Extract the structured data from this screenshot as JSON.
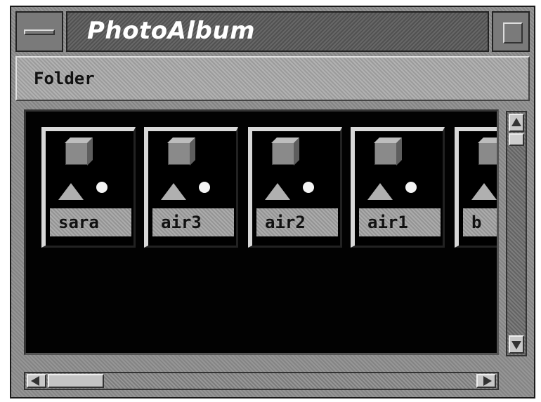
{
  "window": {
    "title": "PhotoAlbum"
  },
  "menubar": {
    "items": [
      {
        "label": "Folder"
      }
    ]
  },
  "album": {
    "items": [
      {
        "label": "sara"
      },
      {
        "label": "air3"
      },
      {
        "label": "air2"
      },
      {
        "label": "air1"
      },
      {
        "label": "b"
      }
    ]
  },
  "icons": {
    "window_menu": "window-menu-icon",
    "maximize": "maximize-icon",
    "album_thumbnail": "scene-thumbnail-icon"
  },
  "colors": {
    "content_background": "#020202",
    "chrome": "#8e8e8e",
    "label_background": "#a0a0a0"
  }
}
